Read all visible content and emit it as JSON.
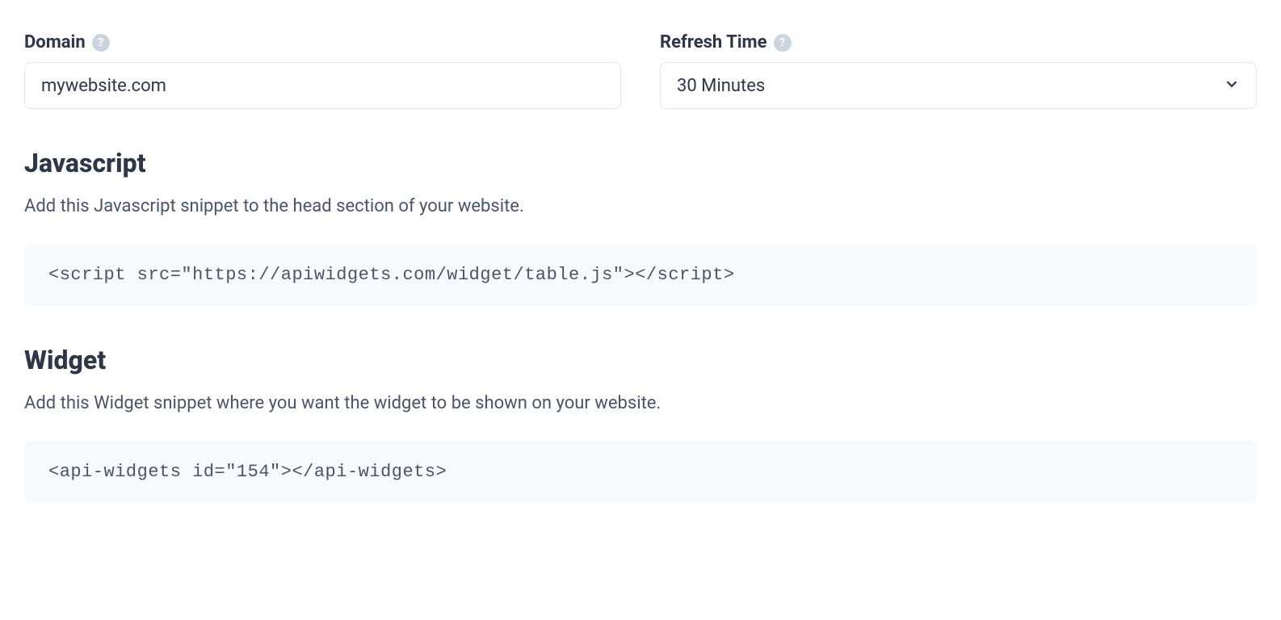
{
  "form": {
    "domain": {
      "label": "Domain",
      "value": "mywebsite.com"
    },
    "refresh": {
      "label": "Refresh Time",
      "value": "30 Minutes"
    }
  },
  "sections": {
    "javascript": {
      "heading": "Javascript",
      "description": "Add this Javascript snippet to the head section of your website.",
      "code": "<script src=\"https://apiwidgets.com/widget/table.js\"></script>"
    },
    "widget": {
      "heading": "Widget",
      "description": "Add this Widget snippet where you want the widget to be shown on your website.",
      "code": "<api-widgets id=\"154\"></api-widgets>"
    }
  }
}
